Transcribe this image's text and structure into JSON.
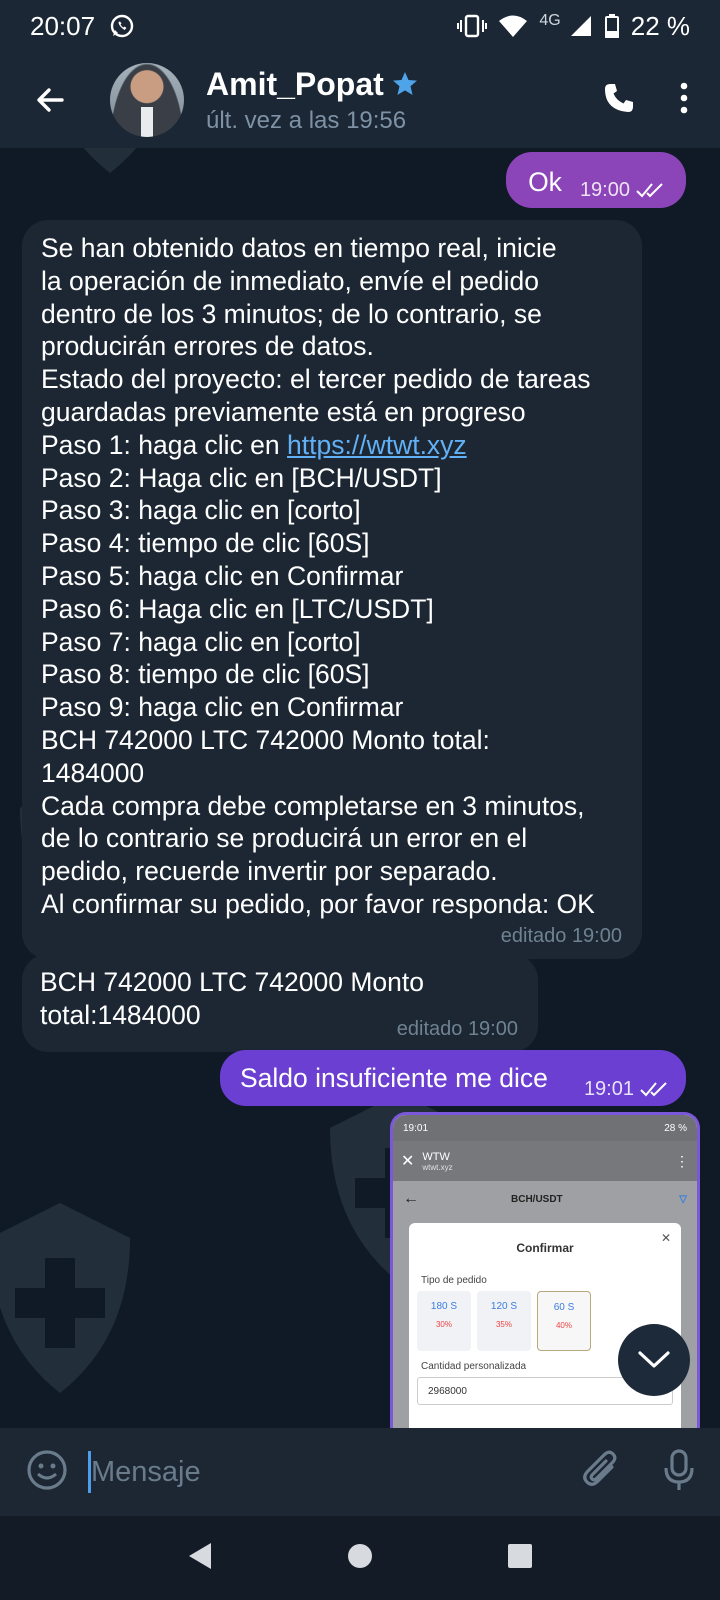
{
  "status_bar": {
    "time": "20:07",
    "network_label": "4G",
    "battery": "22 %"
  },
  "header": {
    "contact_name": "Amit_Popat",
    "last_seen": "últ. vez a las 19:56"
  },
  "messages": {
    "ok": {
      "text": "Ok",
      "time": "19:00"
    },
    "long": {
      "lines": [
        "Se han obtenido datos en tiempo real, inicie",
        "la operación de inmediato, envíe el pedido",
        "dentro de los 3 minutos; de lo contrario, se",
        "producirán errores de datos.",
        "Estado del proyecto: el tercer pedido de tareas",
        "guardadas previamente está en progreso"
      ],
      "step1_prefix": "Paso 1: haga clic en ",
      "step1_link": "https://wtwt.xyz",
      "lines_after": [
        "Paso 2: Haga clic en [BCH/USDT]",
        "Paso 3: haga clic en [corto]",
        "Paso 4: tiempo de clic [60S]",
        "Paso 5: haga clic en Confirmar",
        "Paso 6: Haga clic en [LTC/USDT]",
        "Paso 7: haga clic en [corto]",
        "Paso 8: tiempo de clic [60S]",
        "Paso 9: haga clic en Confirmar",
        "BCH 742000 LTC 742000 Monto total:",
        "1484000",
        "Cada compra debe completarse en 3 minutos,",
        "de lo contrario se producirá un error en el",
        "pedido, recuerde invertir por separado.",
        "Al confirmar su pedido, por favor responda: OK"
      ],
      "edited": "editado 19:00"
    },
    "short": {
      "lines": [
        "BCH 742000 LTC 742000 Monto total:",
        "1484000"
      ],
      "edited": "editado 19:00"
    },
    "saldo": {
      "text": "Saldo insuficiente me dice",
      "time": "19:01"
    }
  },
  "screenshot_preview": {
    "time": "19:01",
    "battery": "28 %",
    "site_title": "WTW",
    "site_url": "wtwt.xyz",
    "pair": "BCH/USDT",
    "modal_title": "Confirmar",
    "order_type_label": "Tipo de pedido",
    "options": [
      {
        "time": "180 S",
        "pct": "30%"
      },
      {
        "time": "120 S",
        "pct": "35%"
      },
      {
        "time": "60 S",
        "pct": "40%"
      }
    ],
    "amount_label": "Cantidad personalizada",
    "amount_value": "2968000"
  },
  "composer": {
    "placeholder": "Mensaje"
  },
  "colors": {
    "bg": "#0e1621",
    "header": "#1b2734",
    "outgoing_purple": "#8c45b8",
    "outgoing_indigo": "#6a3fd1",
    "incoming": "#1c2733",
    "link": "#62b0f5"
  },
  "icons": [
    "whatsapp-icon",
    "vibrate-icon",
    "wifi-icon",
    "signal-icon",
    "battery-icon",
    "back-arrow-icon",
    "verified-star-icon",
    "phone-icon",
    "more-vert-icon",
    "double-check-icon",
    "chevron-down-icon",
    "emoji-icon",
    "attach-icon",
    "mic-icon",
    "nav-back-icon",
    "nav-home-icon",
    "nav-recents-icon"
  ]
}
